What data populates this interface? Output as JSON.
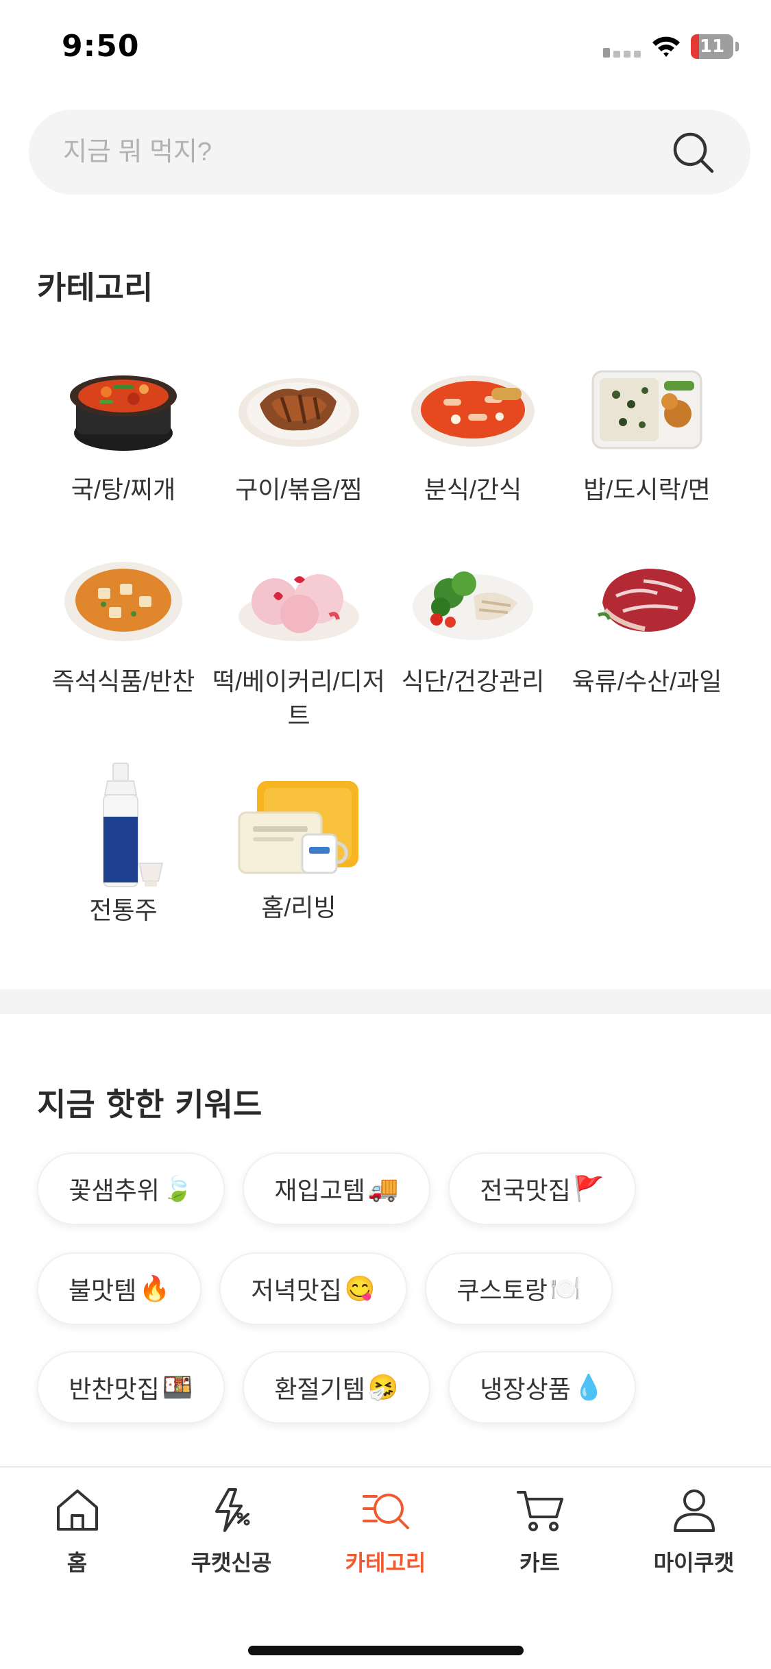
{
  "status_bar": {
    "time": "9:50",
    "battery": "11"
  },
  "search": {
    "placeholder": "지금 뭐 먹지?",
    "value": ""
  },
  "categories_section": {
    "title": "카테고리",
    "items": [
      {
        "label": "국/탕/찌개",
        "icon": "stew-bowl"
      },
      {
        "label": "구이/볶음/찜",
        "icon": "grilled-meat-plate"
      },
      {
        "label": "분식/간식",
        "icon": "tteokbokki-plate"
      },
      {
        "label": "밥/도시락/면",
        "icon": "lunchbox"
      },
      {
        "label": "즉석식품/반찬",
        "icon": "mapo-tofu-plate"
      },
      {
        "label": "떡/베이커리/디저트",
        "icon": "strawberry-rice-cake"
      },
      {
        "label": "식단/건강관리",
        "icon": "salad-plate"
      },
      {
        "label": "육류/수산/과일",
        "icon": "raw-beef"
      },
      {
        "label": "전통주",
        "icon": "liquor-bottle"
      },
      {
        "label": "홈/리빙",
        "icon": "tray-and-mug"
      }
    ]
  },
  "keywords_section": {
    "title": "지금 핫한 키워드",
    "chips": [
      {
        "label": "꽃샘추위",
        "emoji": "🍃"
      },
      {
        "label": "재입고템",
        "emoji": "🚚"
      },
      {
        "label": "전국맛집",
        "emoji": "🚩"
      },
      {
        "label": "불맛템",
        "emoji": "🔥"
      },
      {
        "label": "저녁맛집",
        "emoji": "😋"
      },
      {
        "label": "쿠스토랑",
        "emoji": "🍽️"
      },
      {
        "label": "반찬맛집",
        "emoji": "🍱"
      },
      {
        "label": "환절기템",
        "emoji": "🤧"
      },
      {
        "label": "냉장상품",
        "emoji": "💧"
      }
    ]
  },
  "bottom_nav": {
    "active": "카테고리",
    "active_color": "#f05a30",
    "items": [
      {
        "label": "홈",
        "icon": "home-icon"
      },
      {
        "label": "쿠캣신공",
        "icon": "lightning-icon"
      },
      {
        "label": "카테고리",
        "icon": "category-search-icon"
      },
      {
        "label": "카트",
        "icon": "cart-icon"
      },
      {
        "label": "마이쿠캣",
        "icon": "user-icon"
      }
    ]
  }
}
